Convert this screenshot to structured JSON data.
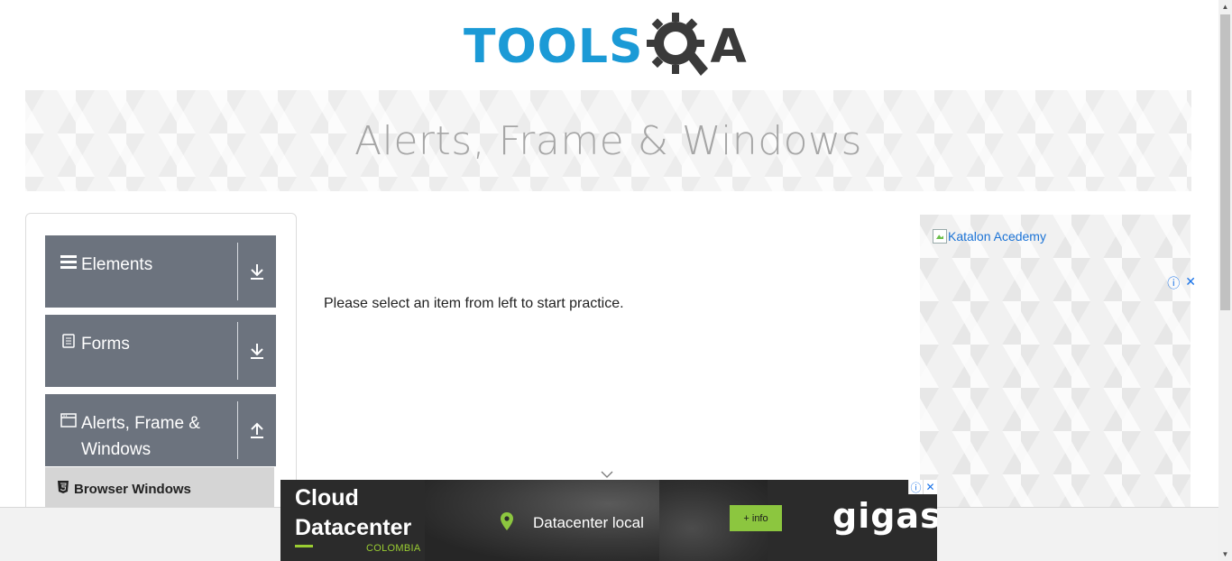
{
  "logo": {
    "part1": "TOOLS",
    "part2": "A"
  },
  "banner": {
    "title": "Alerts, Frame & Windows"
  },
  "sidebar": {
    "groups": [
      {
        "label": "Elements",
        "icon": "menu-icon",
        "toggle_icon": "download-arrow-icon"
      },
      {
        "label": "Forms",
        "icon": "document-icon",
        "toggle_icon": "download-arrow-icon"
      },
      {
        "label": "Alerts, Frame &",
        "label_line2": "Windows",
        "icon": "window-icon",
        "toggle_icon": "upload-arrow-icon"
      }
    ],
    "sub_items": [
      {
        "label": "Browser Windows",
        "icon": "html5-icon"
      }
    ]
  },
  "main": {
    "message": "Please select an item from left to start practice."
  },
  "right_ad": {
    "image_alt": "Katalon Acedemy",
    "info_icon": "ⓘ",
    "close_icon": "✕"
  },
  "bottom_ad": {
    "headline_line1": "Cloud",
    "headline_line2": "Datacenter",
    "country": "COLOMBIA",
    "location": "Datacenter local",
    "button": "+ info",
    "brand": "gigas",
    "info_icon": "ⓘ",
    "close_icon": "✕"
  },
  "colors": {
    "brand_blue": "#1b9ad6",
    "sidebar_group": "#6c737e",
    "ad_green": "#8cc63f"
  }
}
